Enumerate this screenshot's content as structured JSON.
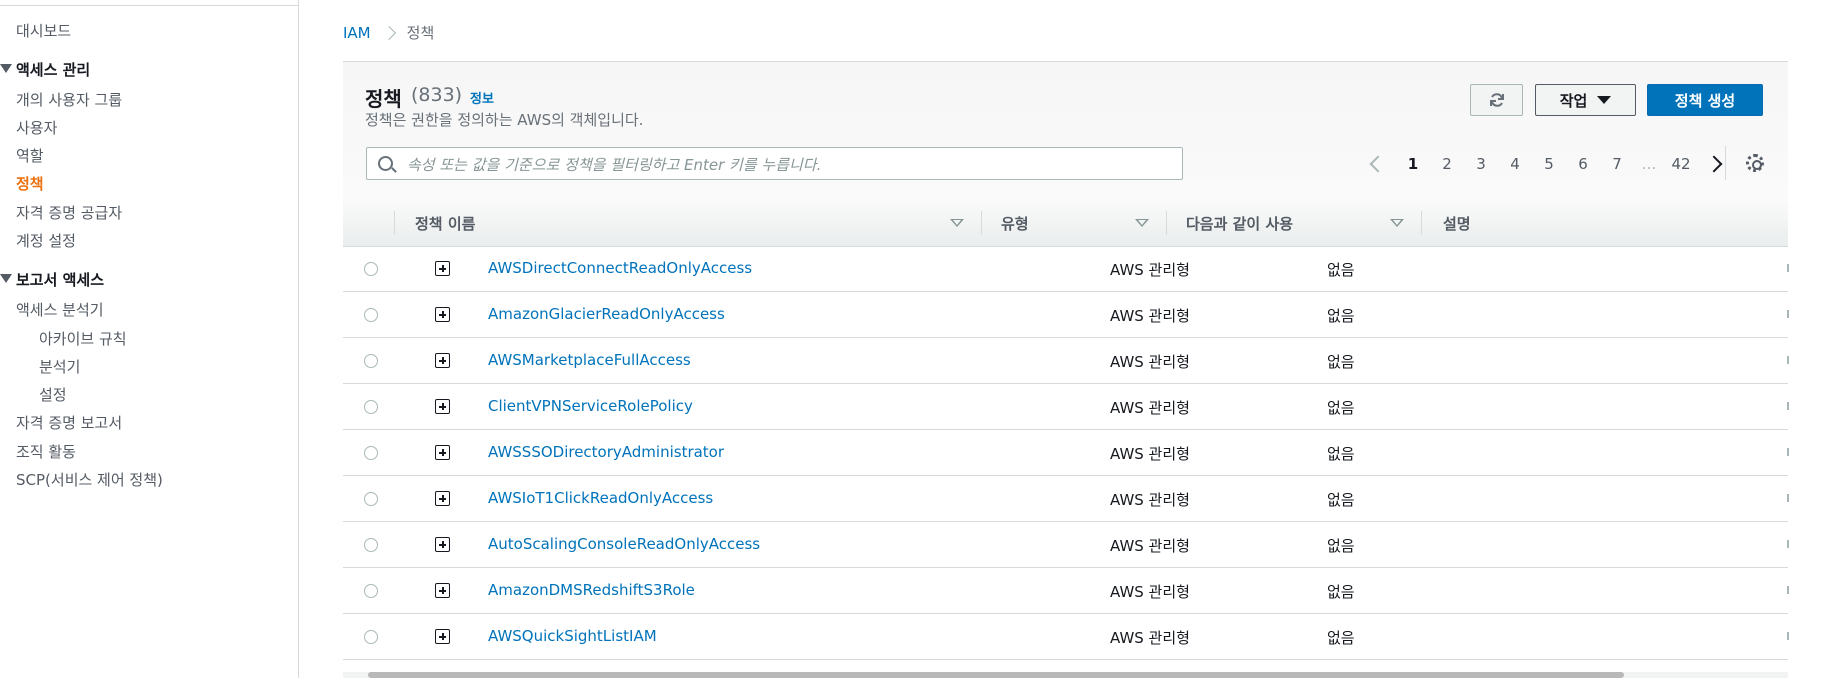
{
  "sidebar": {
    "dashboard": "대시보드",
    "access_management": {
      "title": "액세스 관리",
      "items": [
        "개의 사용자 그룹",
        "사용자",
        "역할",
        "정책",
        "자격 증명 공급자",
        "계정 설정"
      ]
    },
    "access_reports": {
      "title": "보고서 액세스",
      "analyzer": "액세스 분석기",
      "analyzer_items": [
        "아카이브 규칙",
        "분석기",
        "설정"
      ],
      "items": [
        "자격 증명 보고서",
        "조직 활동",
        "SCP(서비스 제어 정책)"
      ]
    },
    "active_item": "정책"
  },
  "breadcrumb": {
    "root": "IAM",
    "current": "정책"
  },
  "header": {
    "title": "정책",
    "count": "(833)",
    "info": "정보",
    "subtitle": "정책은 권한을 정의하는 AWS의 객체입니다.",
    "actions_label": "작업",
    "create_label": "정책 생성"
  },
  "search": {
    "placeholder": "속성 또는 값을 기준으로 정책을 필터링하고 Enter 키를 누릅니다.",
    "value": ""
  },
  "pagination": {
    "pages": [
      "1",
      "2",
      "3",
      "4",
      "5",
      "6",
      "7"
    ],
    "ellipsis": "...",
    "last": "42",
    "current": "1"
  },
  "table": {
    "columns": {
      "name": "정책 이름",
      "type": "유형",
      "used_as": "다음과 같이 사용",
      "description": "설명"
    },
    "rows": [
      {
        "name": "AWSDirectConnectReadOnlyAccess",
        "type": "AWS 관리형",
        "used_as": "없음"
      },
      {
        "name": "AmazonGlacierReadOnlyAccess",
        "type": "AWS 관리형",
        "used_as": "없음"
      },
      {
        "name": "AWSMarketplaceFullAccess",
        "type": "AWS 관리형",
        "used_as": "없음"
      },
      {
        "name": "ClientVPNServiceRolePolicy",
        "type": "AWS 관리형",
        "used_as": "없음"
      },
      {
        "name": "AWSSSODirectoryAdministrator",
        "type": "AWS 관리형",
        "used_as": "없음"
      },
      {
        "name": "AWSIoT1ClickReadOnlyAccess",
        "type": "AWS 관리형",
        "used_as": "없음"
      },
      {
        "name": "AutoScalingConsoleReadOnlyAccess",
        "type": "AWS 관리형",
        "used_as": "없음"
      },
      {
        "name": "AmazonDMSRedshiftS3Role",
        "type": "AWS 관리형",
        "used_as": "없음"
      },
      {
        "name": "AWSQuickSightListIAM",
        "type": "AWS 관리형",
        "used_as": "없음"
      }
    ]
  },
  "icons": {
    "refresh": "refresh-icon",
    "search": "search-icon",
    "settings": "gear-icon",
    "expand": "plus-square-icon",
    "caret": "caret-down-icon"
  },
  "colors": {
    "link": "#0073bb",
    "primary_button": "#0073bb",
    "active_nav": "#ec7211"
  }
}
